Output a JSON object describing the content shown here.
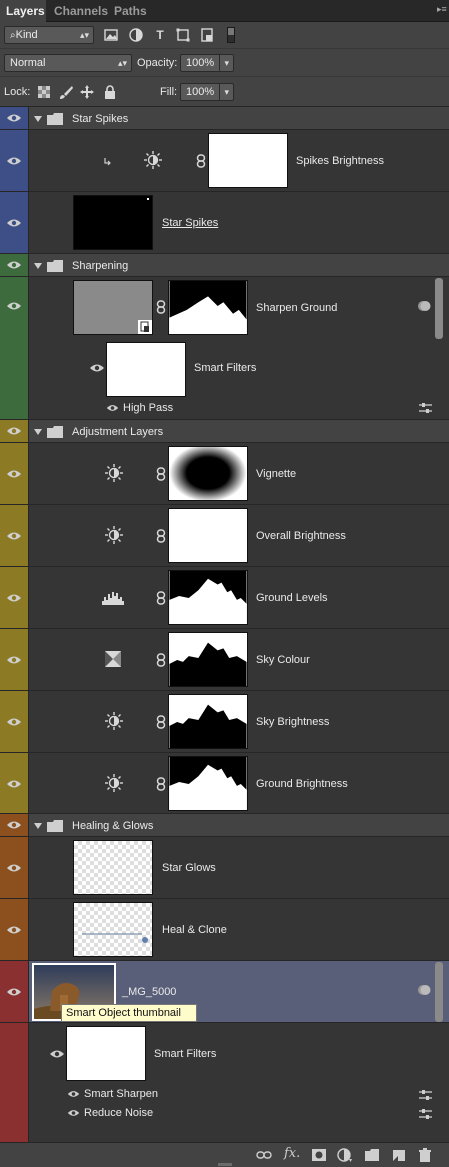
{
  "tabs": [
    "Layers",
    "Channels",
    "Paths"
  ],
  "filter": {
    "kind": "Kind"
  },
  "blend": {
    "mode": "Normal",
    "opacity_label": "Opacity:",
    "opacity": "100%",
    "lock_label": "Lock:",
    "fill_label": "Fill:",
    "fill": "100%"
  },
  "layers": {
    "star_spikes_group": "Star Spikes",
    "spikes_brightness": "Spikes Brightness",
    "star_spikes": "Star Spikes",
    "sharpening_group": "Sharpening",
    "sharpen_ground": "Sharpen Ground",
    "smart_filters_1": "Smart Filters",
    "high_pass": "High Pass",
    "adjustment_group": "Adjustment Layers",
    "vignette": "Vignette",
    "overall_brightness": "Overall Brightness",
    "ground_levels": "Ground Levels",
    "sky_colour": "Sky Colour",
    "sky_brightness": "Sky Brightness",
    "ground_brightness": "Ground Brightness",
    "healing_group": "Healing & Glows",
    "star_glows": "Star Glows",
    "heal_clone": "Heal & Clone",
    "mg5000": "_MG_5000",
    "smart_filters_2": "Smart Filters",
    "smart_sharpen": "Smart Sharpen",
    "reduce_noise": "Reduce Noise"
  },
  "tooltip": "Smart Object thumbnail",
  "colors": {
    "blue": "#3d4f86",
    "green": "#3d6b3d",
    "yellow": "#8c7a24",
    "orange": "#8c501e",
    "red": "#8a3030",
    "selected": "#595f79"
  }
}
